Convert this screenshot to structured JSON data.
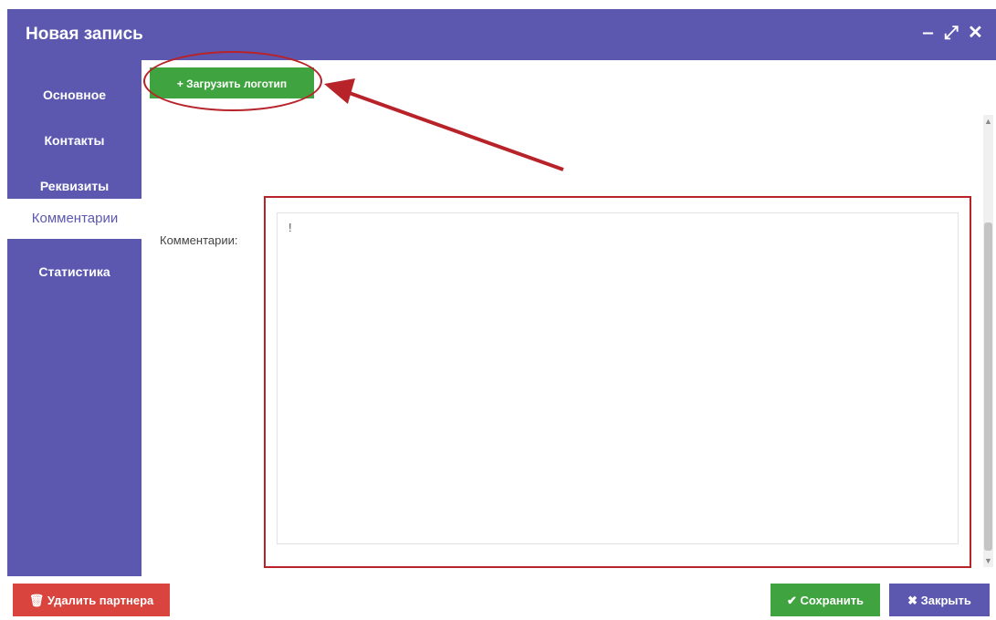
{
  "window": {
    "title": "Новая запись",
    "controls": {
      "minimize": "‒",
      "maximize": "⤢",
      "close": "✕"
    }
  },
  "sidebar": {
    "items": [
      {
        "label": "Основное",
        "active": false
      },
      {
        "label": "Контакты",
        "active": false
      },
      {
        "label": "Реквизиты",
        "active": false
      },
      {
        "label": "Комментарии",
        "active": true
      },
      {
        "label": "Статистика",
        "active": false
      }
    ]
  },
  "content": {
    "upload_logo_label": "+ Загрузить логотип",
    "comments_label": "Комментарии:",
    "comments_value": "!"
  },
  "footer": {
    "delete_label": "🗑 Удалить партнера",
    "save_label": "✔ Сохранить",
    "close_label": "✖ Закрыть"
  },
  "colors": {
    "brand": "#5c58b0",
    "success": "#3fa43f",
    "danger": "#d9443f",
    "annotation": "#b8232a"
  }
}
